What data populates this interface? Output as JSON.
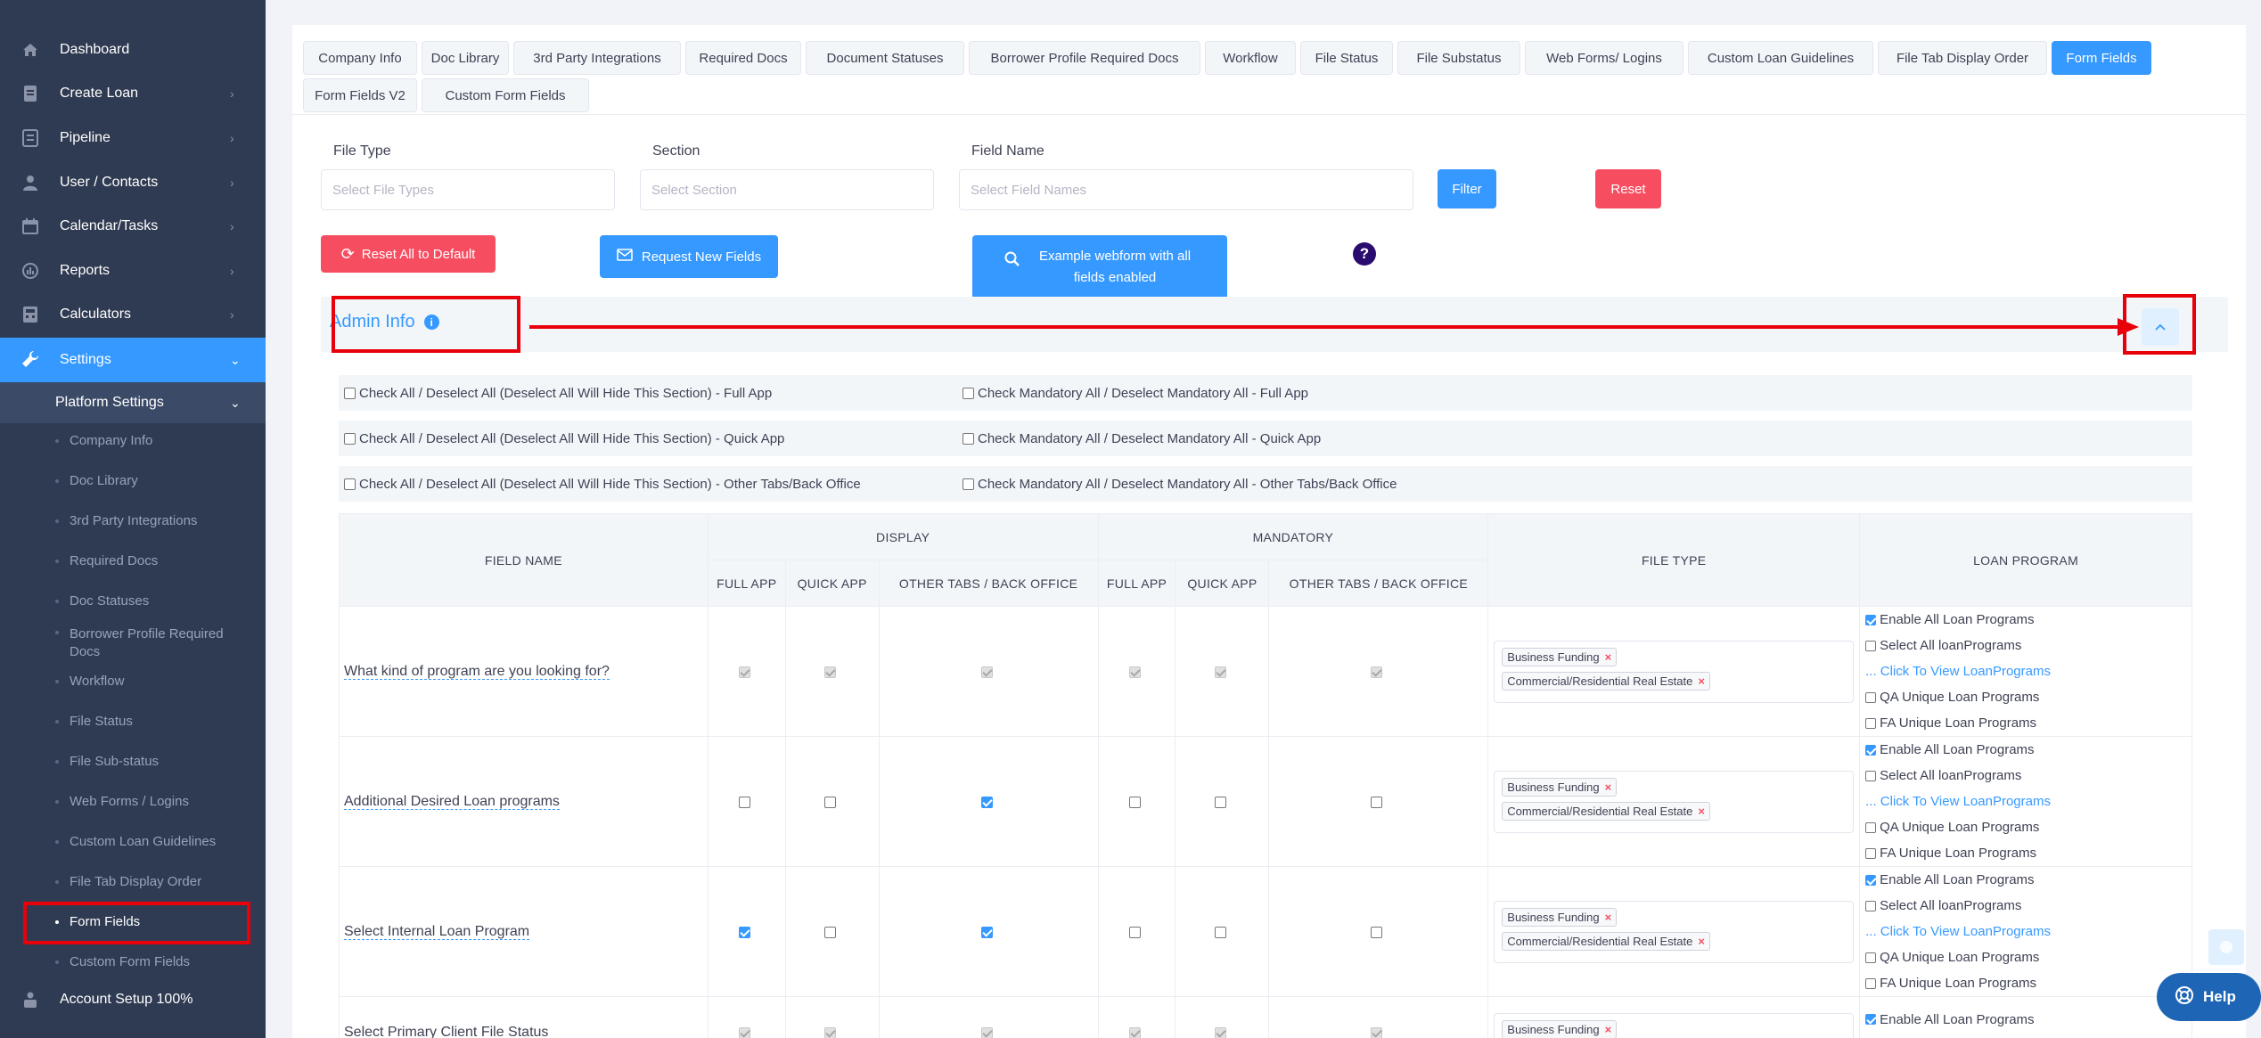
{
  "sidebar": {
    "items": [
      {
        "label": "Dashboard",
        "icon": "home-icon"
      },
      {
        "label": "Create Loan",
        "icon": "document-icon"
      },
      {
        "label": "Pipeline",
        "icon": "list-icon"
      },
      {
        "label": "User / Contacts",
        "icon": "user-icon"
      },
      {
        "label": "Calendar/Tasks",
        "icon": "calendar-icon"
      },
      {
        "label": "Reports",
        "icon": "chart-icon"
      },
      {
        "label": "Calculators",
        "icon": "calculator-icon"
      },
      {
        "label": "Settings",
        "icon": "wrench-icon"
      }
    ],
    "platform_settings": "Platform Settings",
    "children": [
      "Company Info",
      "Doc Library",
      "3rd Party Integrations",
      "Required Docs",
      "Doc Statuses",
      "Borrower Profile Required Docs",
      "Workflow",
      "File Status",
      "File Sub-status",
      "Web Forms / Logins",
      "Custom Loan Guidelines",
      "File Tab Display Order",
      "Form Fields",
      "Custom Form Fields"
    ],
    "account_setup": "Account Setup 100%"
  },
  "tabs": [
    "Company Info",
    "Doc Library",
    "3rd Party Integrations",
    "Required Docs",
    "Document Statuses",
    "Borrower Profile Required Docs",
    "Workflow",
    "File Status",
    "File Substatus",
    "Web Forms/ Logins",
    "Custom Loan Guidelines",
    "File Tab Display Order",
    "Form Fields",
    "Form Fields V2",
    "Custom Form Fields"
  ],
  "active_tab": "Form Fields",
  "filters": {
    "file_type_label": "File Type",
    "file_type_placeholder": "Select File Types",
    "section_label": "Section",
    "section_placeholder": "Select Section",
    "field_name_label": "Field Name",
    "field_name_placeholder": "Select Field Names",
    "filter_btn": "Filter",
    "reset_btn": "Reset"
  },
  "actions": {
    "reset_default": "Reset All to Default",
    "request_new": "Request New Fields",
    "example_webform": "Example webform with all fields enabled",
    "help": "?"
  },
  "section": {
    "title": "Admin Info",
    "info_icon": "i"
  },
  "bulk_checks": [
    {
      "left": "Check All / Deselect All (Deselect All Will Hide This Section) - Full App",
      "right": "Check Mandatory All / Deselect Mandatory All - Full App"
    },
    {
      "left": "Check All / Deselect All (Deselect All Will Hide This Section) - Quick App",
      "right": "Check Mandatory All / Deselect Mandatory All - Quick App"
    },
    {
      "left": "Check All / Deselect All (Deselect All Will Hide This Section) - Other Tabs/Back Office",
      "right": "Check Mandatory All / Deselect Mandatory All - Other Tabs/Back Office"
    }
  ],
  "table": {
    "headers": {
      "field_name": "FIELD NAME",
      "display": "DISPLAY",
      "mandatory": "MANDATORY",
      "file_type": "FILE TYPE",
      "loan_program": "LOAN PROGRAM",
      "full_app": "FULL APP",
      "quick_app": "QUICK APP",
      "other_tabs": "OTHER TABS / BACK OFFICE"
    },
    "loan_program_options": {
      "enable_all": "Enable All Loan Programs",
      "select_all": "Select All loanPrograms",
      "view": "... Click To View LoanPrograms",
      "qa": "QA Unique Loan Programs",
      "fa": "FA Unique Loan Programs"
    },
    "rows": [
      {
        "name": "What kind of program are you looking for?",
        "display": [
          "disabled-checked",
          "disabled-checked",
          "disabled-checked"
        ],
        "mandatory": [
          "disabled-checked",
          "disabled-checked",
          "disabled-checked"
        ],
        "file_types": [
          "Business Funding",
          "Commercial/Residential Real Estate"
        ]
      },
      {
        "name": "Additional Desired Loan programs",
        "display": [
          "unchecked",
          "unchecked",
          "checked"
        ],
        "mandatory": [
          "unchecked",
          "unchecked",
          "unchecked"
        ],
        "file_types": [
          "Business Funding",
          "Commercial/Residential Real Estate"
        ]
      },
      {
        "name": "Select Internal Loan Program",
        "display": [
          "checked",
          "unchecked",
          "checked"
        ],
        "mandatory": [
          "unchecked",
          "unchecked",
          "unchecked"
        ],
        "file_types": [
          "Business Funding",
          "Commercial/Residential Real Estate"
        ]
      },
      {
        "name": "Select Primary Client File Status",
        "display": [
          "disabled-checked",
          "disabled-checked",
          "disabled-checked"
        ],
        "mandatory": [
          "disabled-checked",
          "disabled-checked",
          "disabled-checked"
        ],
        "file_types": [
          "Business Funding"
        ]
      }
    ]
  },
  "help_fab": "Help",
  "colors": {
    "accent": "#3699ff",
    "danger": "#f64e60",
    "sidebar": "#2f3b52",
    "highlight": "#e8000b"
  }
}
